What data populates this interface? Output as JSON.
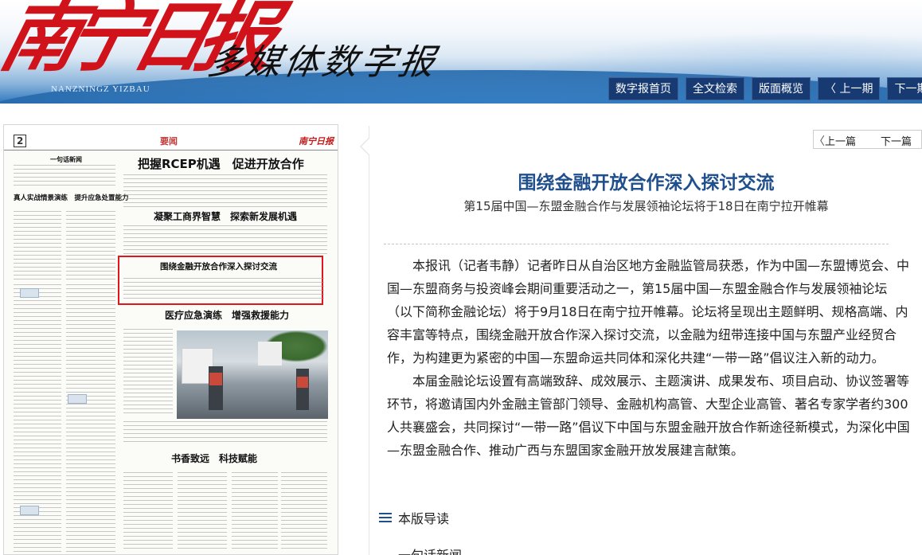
{
  "header": {
    "logo_main": "南宁日报",
    "logo_sub": "多媒体数字报",
    "logo_en": "NANZNINGZ YIZBAU",
    "nav": [
      {
        "label": "数字报首页"
      },
      {
        "label": "全文检索"
      },
      {
        "label": "版面概览"
      },
      {
        "label": "〈 上一期"
      },
      {
        "label": "下一期"
      }
    ]
  },
  "paper": {
    "page_num": "2",
    "page_name": "要闻",
    "logo": "南宁日报",
    "headlines": [
      "把握RCEP机遇　促进开放合作",
      "凝聚工商界智慧　探索新发展机遇",
      "围绕金融开放合作深入探讨交流",
      "医疗应急演练　增强救援能力",
      "书香致远　科技赋能"
    ],
    "left_headline": "真人实战情景演练　提升应急处置能力",
    "left_label": "一句话新闻"
  },
  "article": {
    "pager": {
      "prev": "上一篇",
      "next": "下一篇"
    },
    "title": "围绕金融开放合作深入探讨交流",
    "subtitle": "第15届中国—东盟金融合作与发展领袖论坛将于18日在南宁拉开帷幕",
    "paragraphs": [
      "本报讯（记者韦静）记者昨日从自治区地方金融监管局获悉，作为中国—东盟博览会、中国—东盟商务与投资峰会期间重要活动之一，第15届中国—东盟金融合作与发展领袖论坛（以下简称金融论坛）将于9月18日在南宁拉开帷幕。论坛将呈现出主题鲜明、规格高端、内容丰富等特点，围绕金融开放合作深入探讨交流，以金融为纽带连接中国与东盟产业经贸合作，为构建更为紧密的中国—东盟命运共同体和深化共建“一带一路”倡议注入新的动力。",
      "本届金融论坛设置有高端致辞、成效展示、主题演讲、成果发布、项目启动、协议签署等环节，将邀请国内外金融主管部门领导、金融机构高管、大型企业高管、著名专家学者约300人共襄盛会，共同探讨“一带一路”倡议下中国与东盟金融开放合作新途径新模式，为深化中国—东盟金融合作、推动广西与东盟国家金融开放发展建言献策。"
    ],
    "guide_label": "本版导读",
    "next_item": "一句话新闻"
  }
}
